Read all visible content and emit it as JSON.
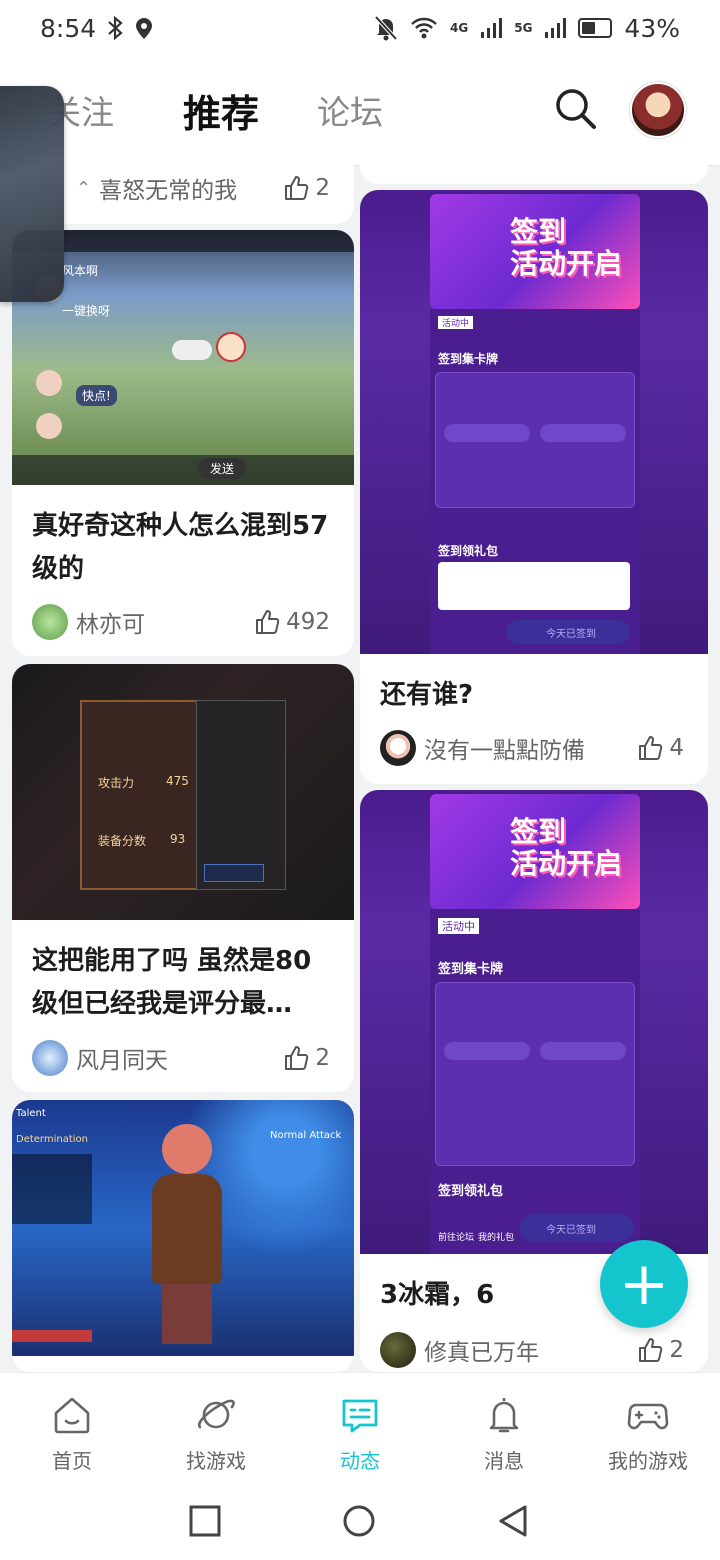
{
  "status_bar": {
    "time": "8:54",
    "signal_4g": "4G",
    "signal_5g": "5G",
    "battery": "43%"
  },
  "header": {
    "tabs": [
      "关注",
      "推荐",
      "论坛"
    ],
    "active_tab": "推荐"
  },
  "feed": {
    "left": [
      {
        "author": "喜怒无常的我",
        "likes": "2"
      },
      {
        "title": "真好奇这种人怎么混到57级的",
        "author": "林亦可",
        "likes": "492",
        "image_text": {
          "send": "发送",
          "msg1": "风本啊",
          "msg2": "一键换呀",
          "msg3": "快点!"
        }
      },
      {
        "title": "这把能用了吗 虽然是80级但已经我是评分最…",
        "author": "风月同天",
        "likes": "2",
        "image_text": {
          "attack": "攻击力",
          "score": "475",
          "equip": "装备分数",
          "equip_val": "93"
        }
      },
      {
        "image_text": {
          "talent": "Talent",
          "normal_attack": "Normal Attack",
          "determination": "Determination"
        }
      }
    ],
    "right": [
      {
        "title": "还有谁?",
        "author": "沒有一點點防備",
        "likes": "4",
        "image_text": {
          "headline_1": "签到",
          "headline_2": "活动开启",
          "badge": "活动中",
          "section": "签到集卡牌",
          "gift": "签到领礼包",
          "btn": "今天已签到"
        }
      },
      {
        "title": "3冰霜，6",
        "author": "修真已万年",
        "likes": "2",
        "image_text": {
          "headline_1": "签到",
          "headline_2": "活动开启",
          "badge": "活动中",
          "section": "签到集卡牌",
          "gift": "签到领礼包",
          "btn": "今天已签到",
          "forum": "前往论坛",
          "mygift": "我的礼包"
        }
      }
    ]
  },
  "fab": {
    "label": "+"
  },
  "bottom_nav": [
    {
      "label": "首页",
      "icon": "home-icon"
    },
    {
      "label": "找游戏",
      "icon": "planet-icon"
    },
    {
      "label": "动态",
      "icon": "feed-icon"
    },
    {
      "label": "消息",
      "icon": "bell-icon"
    },
    {
      "label": "我的游戏",
      "icon": "gamepad-icon"
    }
  ],
  "colors": {
    "accent": "#15c5ce",
    "promo_purple": "#5a2aa5"
  }
}
